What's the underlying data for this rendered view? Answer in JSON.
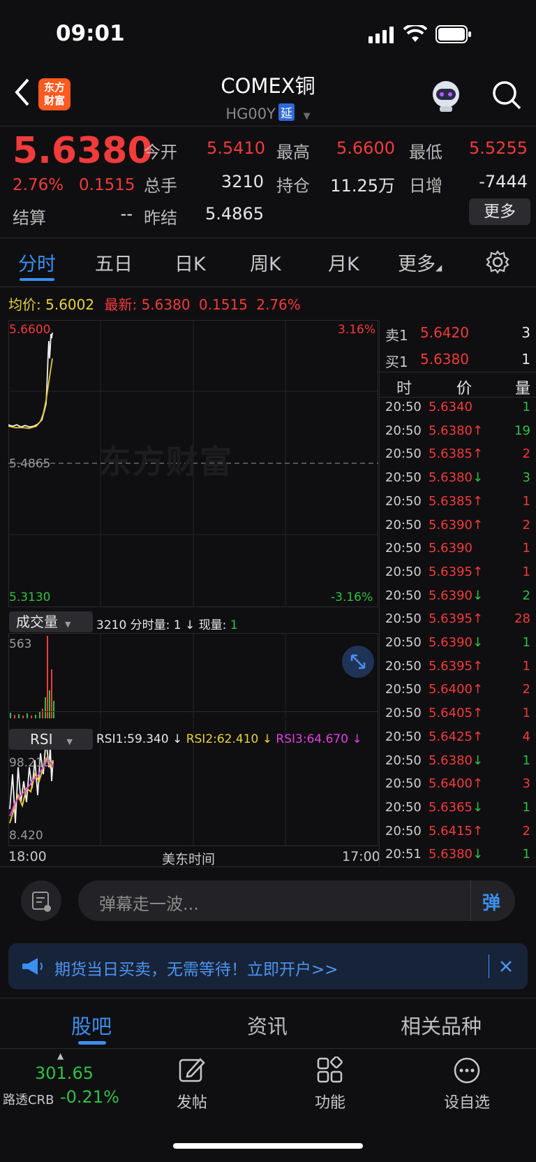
{
  "status_bar": {
    "time": "09:01"
  },
  "header": {
    "title": "COMEX铜",
    "code": "HG00Y",
    "delay_badge": "延",
    "logo_line1": "东方",
    "logo_line2": "财富"
  },
  "quote": {
    "last": "5.6380",
    "change_pct": "2.76%",
    "change": "0.1515",
    "settle_label": "结算",
    "settle_value": "--",
    "open_label": "今开",
    "open_value": "5.5410",
    "volume_label": "总手",
    "volume_value": "3210",
    "prev_settle_label": "昨结",
    "prev_settle_value": "5.4865",
    "high_label": "最高",
    "high_value": "5.6600",
    "oi_label": "持仓",
    "oi_value": "11.25万",
    "low_label": "最低",
    "low_value": "5.5255",
    "daily_inc_label": "日增",
    "daily_inc_value": "-7444",
    "more_label": "更多"
  },
  "tabs": [
    "分时",
    "五日",
    "日K",
    "周K",
    "月K",
    "更多"
  ],
  "avg_line": {
    "avg_label": "均价:",
    "avg_value": "5.6002",
    "latest_label": "最新:",
    "latest_value": "5.6380",
    "change": "0.1515",
    "change_pct": "2.76%"
  },
  "chart": {
    "high_price": "5.6600",
    "high_pct": "3.16%",
    "mid_price": "5.4865",
    "low_price": "5.3130",
    "low_pct": "-3.16%",
    "watermark": "东方财富",
    "volume_label": "成交量",
    "volume_info_total": "3210",
    "volume_info_min": "分时量: 1 ↓",
    "volume_info_now_label": "现量:",
    "volume_info_now": "1",
    "volume_max": "563",
    "rsi_label": "RSI",
    "rsi1": "RSI1:59.340 ↓",
    "rsi2": "RSI2:62.410 ↓",
    "rsi3": "RSI3:64.670 ↓",
    "rsi_top": "98.210",
    "rsi_bottom": "8.420",
    "time_start": "18:00",
    "time_mid": "美东时间",
    "time_end": "17:00"
  },
  "orderbook": {
    "ask_label": "卖1",
    "ask_price": "5.6420",
    "ask_vol": "3",
    "bid_label": "买1",
    "bid_price": "5.6380",
    "bid_vol": "1",
    "col_time": "时",
    "col_price": "价",
    "col_vol": "量",
    "trades": [
      {
        "time": "20:50",
        "price": "5.6340",
        "vol": "1",
        "dir": "",
        "vcolor": "green"
      },
      {
        "time": "20:50",
        "price": "5.6380↑",
        "vol": "19",
        "dir": "up",
        "vcolor": "green"
      },
      {
        "time": "20:50",
        "price": "5.6385↑",
        "vol": "2",
        "dir": "up",
        "vcolor": "red"
      },
      {
        "time": "20:50",
        "price": "5.6380↓",
        "vol": "3",
        "dir": "down",
        "vcolor": "green"
      },
      {
        "time": "20:50",
        "price": "5.6385↑",
        "vol": "1",
        "dir": "up",
        "vcolor": "red"
      },
      {
        "time": "20:50",
        "price": "5.6390↑",
        "vol": "2",
        "dir": "up",
        "vcolor": "red"
      },
      {
        "time": "20:50",
        "price": "5.6390",
        "vol": "1",
        "dir": "",
        "vcolor": "red"
      },
      {
        "time": "20:50",
        "price": "5.6395↑",
        "vol": "1",
        "dir": "up",
        "vcolor": "red"
      },
      {
        "time": "20:50",
        "price": "5.6390↓",
        "vol": "2",
        "dir": "down",
        "vcolor": "green"
      },
      {
        "time": "20:50",
        "price": "5.6395↑",
        "vol": "28",
        "dir": "up",
        "vcolor": "red"
      },
      {
        "time": "20:50",
        "price": "5.6390↓",
        "vol": "1",
        "dir": "down",
        "vcolor": "green"
      },
      {
        "time": "20:50",
        "price": "5.6395↑",
        "vol": "1",
        "dir": "up",
        "vcolor": "red"
      },
      {
        "time": "20:50",
        "price": "5.6400↑",
        "vol": "2",
        "dir": "up",
        "vcolor": "red"
      },
      {
        "time": "20:50",
        "price": "5.6405↑",
        "vol": "1",
        "dir": "up",
        "vcolor": "red"
      },
      {
        "time": "20:50",
        "price": "5.6425↑",
        "vol": "4",
        "dir": "up",
        "vcolor": "red"
      },
      {
        "time": "20:50",
        "price": "5.6380↓",
        "vol": "1",
        "dir": "down",
        "vcolor": "green"
      },
      {
        "time": "20:50",
        "price": "5.6400↑",
        "vol": "3",
        "dir": "up",
        "vcolor": "red"
      },
      {
        "time": "20:50",
        "price": "5.6365↓",
        "vol": "1",
        "dir": "down",
        "vcolor": "green"
      },
      {
        "time": "20:50",
        "price": "5.6415↑",
        "vol": "2",
        "dir": "up",
        "vcolor": "red"
      },
      {
        "time": "20:51",
        "price": "5.6380↓",
        "vol": "1",
        "dir": "down",
        "vcolor": "green"
      }
    ]
  },
  "comment": {
    "placeholder": "弹幕走一波...",
    "danmu_btn": "弹"
  },
  "banner": {
    "text": "期货当日买卖，无需等待！立即开户>>"
  },
  "bottom_tabs": [
    "股吧",
    "资讯",
    "相关品种"
  ],
  "bottom_nav": {
    "index_value": "301.65",
    "index_name": "路透CRB",
    "index_change": "-0.21%",
    "post_label": "发帖",
    "func_label": "功能",
    "watch_label": "设自选"
  },
  "colors": {
    "up": "#f23b3b",
    "down": "#2fc144",
    "accent": "#3a8ff0",
    "background": "#0f0f11"
  }
}
